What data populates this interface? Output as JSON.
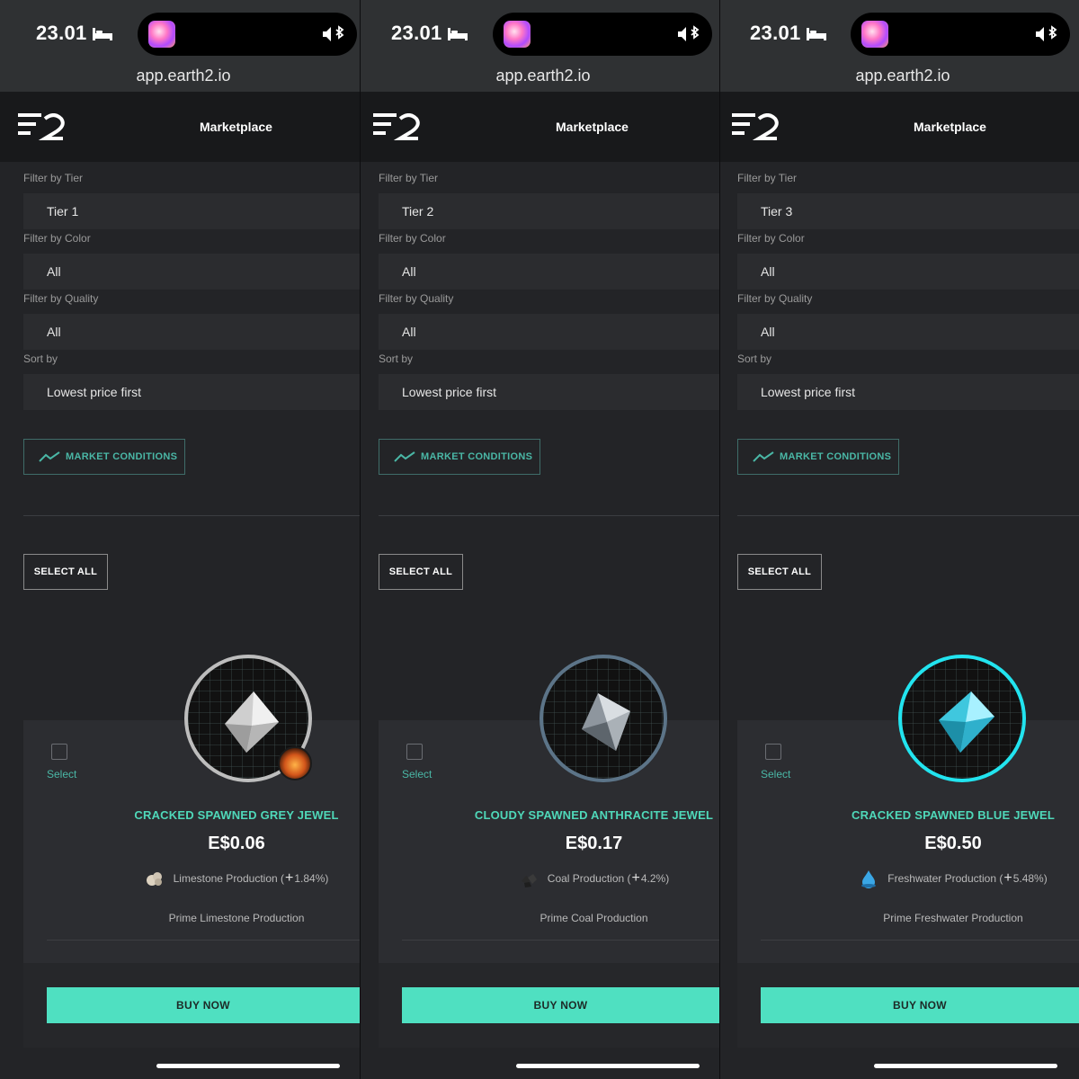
{
  "colors": {
    "accent_teal": "#4fe0c1",
    "label_teal": "#4ab7a6",
    "ring_grey": "#bdbdbd",
    "ring_anthracite": "#5c7488",
    "ring_blue": "#22e4ef"
  },
  "icons": {
    "status": [
      "bed-icon",
      "speaker-bluetooth-icon"
    ],
    "market": "trend-line-icon",
    "logo": "earth2-logo"
  },
  "panels": [
    {
      "status": {
        "time": "23.01"
      },
      "url": "app.earth2.io",
      "nav": {
        "title": "Marketplace"
      },
      "filters": {
        "tier_label": "Filter by Tier",
        "tier_value": "Tier 1",
        "color_label": "Filter by Color",
        "color_value": "All",
        "quality_label": "Filter by Quality",
        "quality_value": "All",
        "sort_label": "Sort by",
        "sort_value": "Lowest price first"
      },
      "market_conditions_label": "MARKET CONDITIONS",
      "select_all_label": "SELECT ALL",
      "item": {
        "select_label": "Select",
        "name": "CRACKED SPAWNED GREY JEWEL",
        "price": "E$0.06",
        "boost": "Limestone Production (",
        "boost_value": "1.84%)",
        "prime": "Prime Limestone Production",
        "buy_label": "BUY NOW"
      }
    },
    {
      "status": {
        "time": "23.01"
      },
      "url": "app.earth2.io",
      "nav": {
        "title": "Marketplace"
      },
      "filters": {
        "tier_label": "Filter by Tier",
        "tier_value": "Tier 2",
        "color_label": "Filter by Color",
        "color_value": "All",
        "quality_label": "Filter by Quality",
        "quality_value": "All",
        "sort_label": "Sort by",
        "sort_value": "Lowest price first"
      },
      "market_conditions_label": "MARKET CONDITIONS",
      "select_all_label": "SELECT ALL",
      "item": {
        "select_label": "Select",
        "name": "CLOUDY SPAWNED ANTHRACITE JEWEL",
        "price": "E$0.17",
        "boost": "Coal Production (",
        "boost_value": "4.2%)",
        "prime": "Prime Coal Production",
        "buy_label": "BUY NOW"
      }
    },
    {
      "status": {
        "time": "23.01"
      },
      "url": "app.earth2.io",
      "nav": {
        "title": "Marketplace"
      },
      "filters": {
        "tier_label": "Filter by Tier",
        "tier_value": "Tier 3",
        "color_label": "Filter by Color",
        "color_value": "All",
        "quality_label": "Filter by Quality",
        "quality_value": "All",
        "sort_label": "Sort by",
        "sort_value": "Lowest price first"
      },
      "market_conditions_label": "MARKET CONDITIONS",
      "select_all_label": "SELECT ALL",
      "item": {
        "select_label": "Select",
        "name": "CRACKED SPAWNED BLUE JEWEL",
        "price": "E$0.50",
        "boost": "Freshwater Production (",
        "boost_value": "5.48%)",
        "prime": "Prime Freshwater Production",
        "buy_label": "BUY NOW"
      }
    }
  ]
}
